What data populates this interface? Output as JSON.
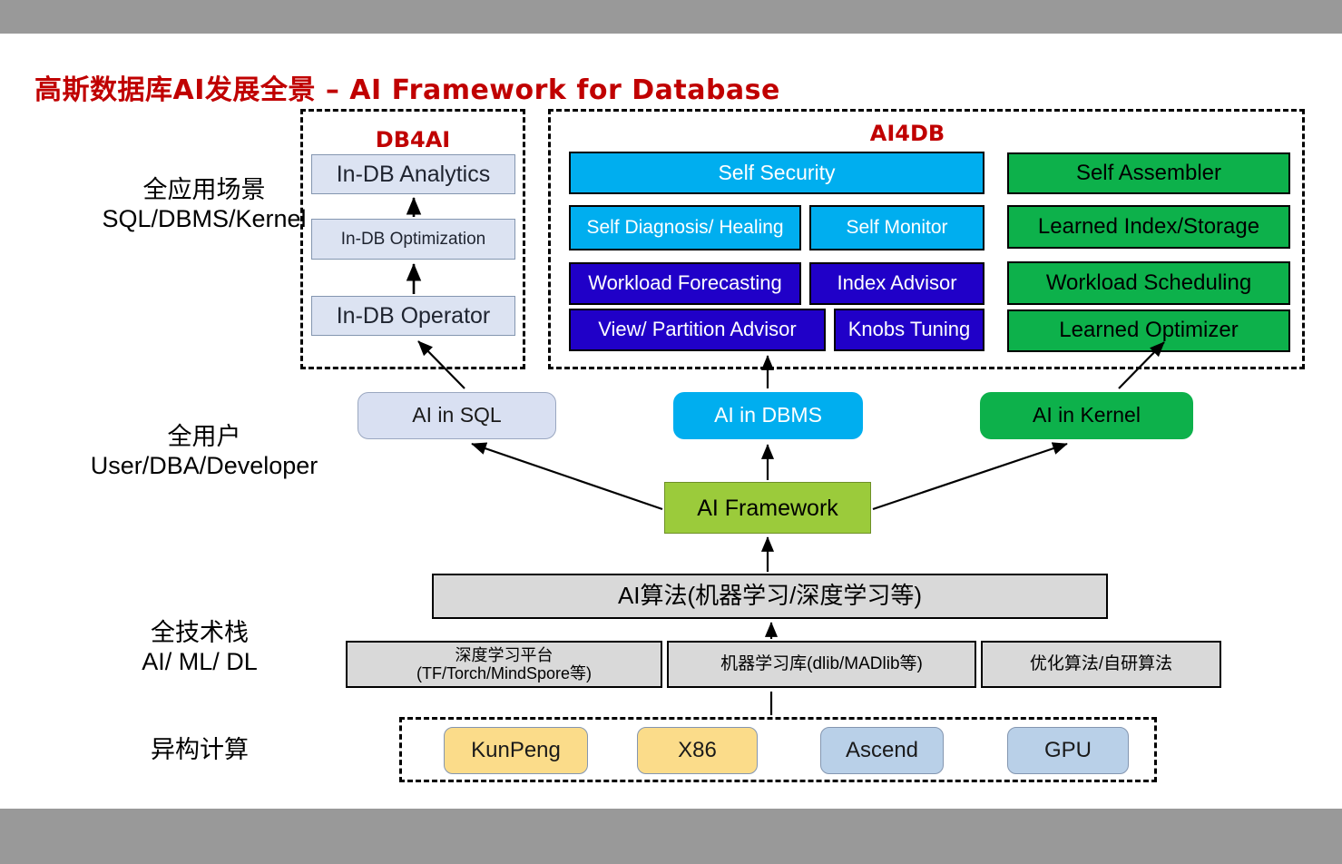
{
  "title": "高斯数据库AI发展全景 – AI Framework for Database",
  "row_labels": [
    {
      "line1": "全应用场景",
      "line2": "SQL/DBMS/Kernel"
    },
    {
      "line1": "全用户",
      "line2": "User/DBA/Developer"
    },
    {
      "line1": "全技术栈",
      "line2": "AI/ ML/ DL"
    },
    {
      "line1": "异构计算",
      "line2": ""
    }
  ],
  "db4ai": {
    "title": "DB4AI",
    "boxes": [
      {
        "label": "In-DB Analytics"
      },
      {
        "label": "In-DB Optimization"
      },
      {
        "label": "In-DB Operator"
      }
    ]
  },
  "ai4db": {
    "title": "AI4DB",
    "left_boxes": [
      {
        "label": "Self Security"
      },
      {
        "label": "Self Diagnosis/ Healing"
      },
      {
        "label": "Self Monitor"
      },
      {
        "label": "Workload Forecasting"
      },
      {
        "label": "Index Advisor"
      },
      {
        "label": "View/ Partition Advisor"
      },
      {
        "label": "Knobs Tuning"
      }
    ],
    "right_boxes": [
      {
        "label": "Self Assembler"
      },
      {
        "label": "Learned Index/Storage"
      },
      {
        "label": "Workload Scheduling"
      },
      {
        "label": "Learned Optimizer"
      }
    ]
  },
  "mid_row": [
    {
      "label": "AI in SQL"
    },
    {
      "label": "AI in DBMS"
    },
    {
      "label": "AI in Kernel"
    }
  ],
  "framework": {
    "label": "AI Framework"
  },
  "algo_box": {
    "label": "AI算法(机器学习/深度学习等)"
  },
  "stack_row": [
    {
      "line1": "深度学习平台",
      "line2": "(TF/Torch/MindSpore等)"
    },
    {
      "line1": "机器学习库(dlib/MADlib等)",
      "line2": ""
    },
    {
      "line1": "优化算法/自研算法",
      "line2": ""
    }
  ],
  "hardware": [
    {
      "label": "KunPeng"
    },
    {
      "label": "X86"
    },
    {
      "label": "Ascend"
    },
    {
      "label": "GPU"
    }
  ],
  "colors": {
    "title_red": "#C00000",
    "cyan": "#00AEEF",
    "navy": "#2000C8",
    "green": "#0DB14B",
    "pale_blue": "#DCE3F2",
    "yellow_green": "#9BCB3B",
    "gray_fill": "#D9D9D9",
    "amber": "#FBDC8A",
    "light_blue": "#B9D0E8",
    "band_gray": "#999999"
  }
}
